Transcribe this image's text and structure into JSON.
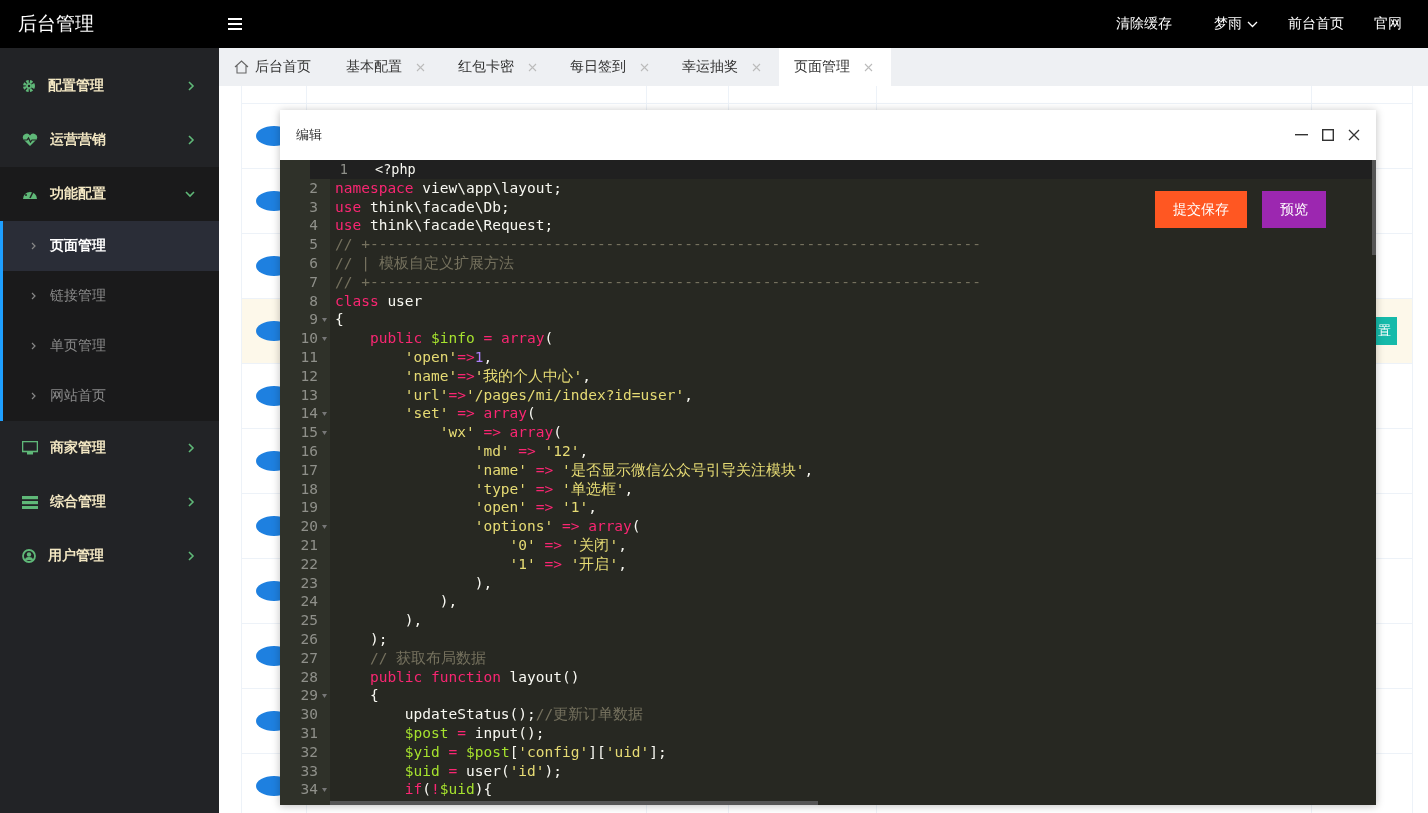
{
  "header": {
    "title": "后台管理",
    "actions": [
      {
        "label": "清除缓存",
        "dropdown": false
      },
      {
        "label": "梦雨",
        "dropdown": true
      },
      {
        "label": "前台首页",
        "dropdown": false
      },
      {
        "label": "官网",
        "dropdown": false
      }
    ]
  },
  "sidebar": {
    "items": [
      {
        "label": "配置管理",
        "expanded": false
      },
      {
        "label": "运营营销",
        "expanded": false
      },
      {
        "label": "功能配置",
        "expanded": true,
        "children": [
          {
            "label": "页面管理",
            "selected": true
          },
          {
            "label": "链接管理",
            "selected": false
          },
          {
            "label": "单页管理",
            "selected": false
          },
          {
            "label": "网站首页",
            "selected": false
          }
        ]
      },
      {
        "label": "商家管理",
        "expanded": false
      },
      {
        "label": "综合管理",
        "expanded": false
      },
      {
        "label": "用户管理",
        "expanded": false
      }
    ]
  },
  "tabs": [
    {
      "label": "后台首页",
      "kind": "home",
      "selected": false
    },
    {
      "label": "基本配置",
      "kind": "page",
      "selected": false
    },
    {
      "label": "红包卡密",
      "kind": "page",
      "selected": false
    },
    {
      "label": "每日签到",
      "kind": "page",
      "selected": false
    },
    {
      "label": "幸运抽奖",
      "kind": "page",
      "selected": false
    },
    {
      "label": "页面管理",
      "kind": "page",
      "selected": true
    }
  ],
  "table": {
    "rows": [
      {
        "selected": false
      },
      {
        "selected": false
      },
      {
        "selected": false
      },
      {
        "selected": true,
        "action": "置"
      },
      {
        "selected": false
      },
      {
        "selected": false
      },
      {
        "selected": false
      },
      {
        "selected": false
      },
      {
        "selected": false
      },
      {
        "selected": false
      },
      {
        "selected": false
      }
    ]
  },
  "dialog": {
    "title": "编辑",
    "buttons": [
      {
        "label": "提交保存",
        "color": "#ff5722"
      },
      {
        "label": "预览",
        "color": "#9c27b0"
      }
    ],
    "lines": [
      {
        "n": "1",
        "fold": false,
        "active": true,
        "t": [
          {
            "kind": "plain",
            "text": "<?php"
          }
        ]
      },
      {
        "n": "2",
        "fold": false,
        "active": false,
        "t": [
          {
            "kind": "keyword",
            "text": "namespace"
          },
          {
            "kind": "plain",
            "text": " view\\app\\layout;"
          }
        ]
      },
      {
        "n": "3",
        "fold": false,
        "active": false,
        "t": [
          {
            "kind": "keyword",
            "text": "use"
          },
          {
            "kind": "plain",
            "text": " think\\facade\\Db;"
          }
        ]
      },
      {
        "n": "4",
        "fold": false,
        "active": false,
        "t": [
          {
            "kind": "keyword",
            "text": "use"
          },
          {
            "kind": "plain",
            "text": " think\\facade\\Request;"
          }
        ]
      },
      {
        "n": "5",
        "fold": false,
        "active": false,
        "t": [
          {
            "kind": "comment",
            "text": "// +----------------------------------------------------------------------"
          }
        ]
      },
      {
        "n": "6",
        "fold": false,
        "active": false,
        "t": [
          {
            "kind": "comment",
            "text": "// | 模板自定义扩展方法"
          }
        ]
      },
      {
        "n": "7",
        "fold": false,
        "active": false,
        "t": [
          {
            "kind": "comment",
            "text": "// +----------------------------------------------------------------------"
          }
        ]
      },
      {
        "n": "8",
        "fold": false,
        "active": false,
        "t": [
          {
            "kind": "keyword",
            "text": "class"
          },
          {
            "kind": "plain",
            "text": " user"
          }
        ]
      },
      {
        "n": "9",
        "fold": true,
        "active": false,
        "t": [
          {
            "kind": "plain",
            "text": "{"
          }
        ]
      },
      {
        "n": "10",
        "fold": true,
        "active": false,
        "t": [
          {
            "kind": "keyword",
            "text": "    public"
          },
          {
            "kind": "variable",
            "text": " $info"
          },
          {
            "kind": "operator",
            "text": " ="
          },
          {
            "kind": "keyword",
            "text": " array"
          },
          {
            "kind": "plain",
            "text": "("
          }
        ]
      },
      {
        "n": "11",
        "fold": false,
        "active": false,
        "t": [
          {
            "kind": "string",
            "text": "        'open'"
          },
          {
            "kind": "operator",
            "text": "=>"
          },
          {
            "kind": "number",
            "text": "1"
          },
          {
            "kind": "plain",
            "text": ","
          }
        ]
      },
      {
        "n": "12",
        "fold": false,
        "active": false,
        "t": [
          {
            "kind": "string",
            "text": "        'name'"
          },
          {
            "kind": "operator",
            "text": "=>"
          },
          {
            "kind": "string",
            "text": "'我的个人中心'"
          },
          {
            "kind": "plain",
            "text": ","
          }
        ]
      },
      {
        "n": "13",
        "fold": false,
        "active": false,
        "t": [
          {
            "kind": "string",
            "text": "        'url'"
          },
          {
            "kind": "operator",
            "text": "=>"
          },
          {
            "kind": "string",
            "text": "'/pages/mi/index?id=user'"
          },
          {
            "kind": "plain",
            "text": ","
          }
        ]
      },
      {
        "n": "14",
        "fold": true,
        "active": false,
        "t": [
          {
            "kind": "string",
            "text": "        'set'"
          },
          {
            "kind": "operator",
            "text": " =>"
          },
          {
            "kind": "keyword",
            "text": " array"
          },
          {
            "kind": "plain",
            "text": "("
          }
        ]
      },
      {
        "n": "15",
        "fold": true,
        "active": false,
        "t": [
          {
            "kind": "string",
            "text": "            'wx'"
          },
          {
            "kind": "operator",
            "text": " =>"
          },
          {
            "kind": "keyword",
            "text": " array"
          },
          {
            "kind": "plain",
            "text": "("
          }
        ]
      },
      {
        "n": "16",
        "fold": false,
        "active": false,
        "t": [
          {
            "kind": "string",
            "text": "                'md'"
          },
          {
            "kind": "operator",
            "text": " =>"
          },
          {
            "kind": "string",
            "text": " '12'"
          },
          {
            "kind": "plain",
            "text": ","
          }
        ]
      },
      {
        "n": "17",
        "fold": false,
        "active": false,
        "t": [
          {
            "kind": "string",
            "text": "                'name'"
          },
          {
            "kind": "operator",
            "text": " =>"
          },
          {
            "kind": "string",
            "text": " '是否显示微信公众号引导关注模块'"
          },
          {
            "kind": "plain",
            "text": ","
          }
        ]
      },
      {
        "n": "18",
        "fold": false,
        "active": false,
        "t": [
          {
            "kind": "string",
            "text": "                'type'"
          },
          {
            "kind": "operator",
            "text": " =>"
          },
          {
            "kind": "string",
            "text": " '单选框'"
          },
          {
            "kind": "plain",
            "text": ","
          }
        ]
      },
      {
        "n": "19",
        "fold": false,
        "active": false,
        "t": [
          {
            "kind": "string",
            "text": "                'open'"
          },
          {
            "kind": "operator",
            "text": " =>"
          },
          {
            "kind": "string",
            "text": " '1'"
          },
          {
            "kind": "plain",
            "text": ","
          }
        ]
      },
      {
        "n": "20",
        "fold": true,
        "active": false,
        "t": [
          {
            "kind": "string",
            "text": "                'options'"
          },
          {
            "kind": "operator",
            "text": " =>"
          },
          {
            "kind": "keyword",
            "text": " array"
          },
          {
            "kind": "plain",
            "text": "("
          }
        ]
      },
      {
        "n": "21",
        "fold": false,
        "active": false,
        "t": [
          {
            "kind": "string",
            "text": "                    '0'"
          },
          {
            "kind": "operator",
            "text": " =>"
          },
          {
            "kind": "string",
            "text": " '关闭'"
          },
          {
            "kind": "plain",
            "text": ","
          }
        ]
      },
      {
        "n": "22",
        "fold": false,
        "active": false,
        "t": [
          {
            "kind": "string",
            "text": "                    '1'"
          },
          {
            "kind": "operator",
            "text": " =>"
          },
          {
            "kind": "string",
            "text": " '开启'"
          },
          {
            "kind": "plain",
            "text": ","
          }
        ]
      },
      {
        "n": "23",
        "fold": false,
        "active": false,
        "t": [
          {
            "kind": "plain",
            "text": "                ),"
          }
        ]
      },
      {
        "n": "24",
        "fold": false,
        "active": false,
        "t": [
          {
            "kind": "plain",
            "text": "            ),"
          }
        ]
      },
      {
        "n": "25",
        "fold": false,
        "active": false,
        "t": [
          {
            "kind": "plain",
            "text": "        ),"
          }
        ]
      },
      {
        "n": "26",
        "fold": false,
        "active": false,
        "t": [
          {
            "kind": "plain",
            "text": "    );"
          }
        ]
      },
      {
        "n": "27",
        "fold": false,
        "active": false,
        "t": [
          {
            "kind": "comment",
            "text": "    // 获取布局数据"
          }
        ]
      },
      {
        "n": "28",
        "fold": false,
        "active": false,
        "t": [
          {
            "kind": "keyword",
            "text": "    public"
          },
          {
            "kind": "keyword",
            "text": " function"
          },
          {
            "kind": "plain",
            "text": " layout()"
          }
        ]
      },
      {
        "n": "29",
        "fold": true,
        "active": false,
        "t": [
          {
            "kind": "plain",
            "text": "    {"
          }
        ]
      },
      {
        "n": "30",
        "fold": false,
        "active": false,
        "t": [
          {
            "kind": "plain",
            "text": "        updateStatus();"
          },
          {
            "kind": "comment",
            "text": "//更新订单数据"
          }
        ]
      },
      {
        "n": "31",
        "fold": false,
        "active": false,
        "t": [
          {
            "kind": "variable",
            "text": "        $post"
          },
          {
            "kind": "operator",
            "text": " ="
          },
          {
            "kind": "plain",
            "text": " input();"
          }
        ]
      },
      {
        "n": "32",
        "fold": false,
        "active": false,
        "t": [
          {
            "kind": "variable",
            "text": "        $yid"
          },
          {
            "kind": "operator",
            "text": " ="
          },
          {
            "kind": "variable",
            "text": " $post"
          },
          {
            "kind": "plain",
            "text": "["
          },
          {
            "kind": "string",
            "text": "'config'"
          },
          {
            "kind": "plain",
            "text": "]["
          },
          {
            "kind": "string",
            "text": "'uid'"
          },
          {
            "kind": "plain",
            "text": "];"
          }
        ]
      },
      {
        "n": "33",
        "fold": false,
        "active": false,
        "t": [
          {
            "kind": "variable",
            "text": "        $uid"
          },
          {
            "kind": "operator",
            "text": " ="
          },
          {
            "kind": "plain",
            "text": " user("
          },
          {
            "kind": "string",
            "text": "'id'"
          },
          {
            "kind": "plain",
            "text": ");"
          }
        ]
      },
      {
        "n": "34",
        "fold": true,
        "active": false,
        "t": [
          {
            "kind": "keyword",
            "text": "        if"
          },
          {
            "kind": "plain",
            "text": "("
          },
          {
            "kind": "operator",
            "text": "!"
          },
          {
            "kind": "variable",
            "text": "$uid"
          },
          {
            "kind": "plain",
            "text": "){"
          }
        ]
      }
    ]
  }
}
